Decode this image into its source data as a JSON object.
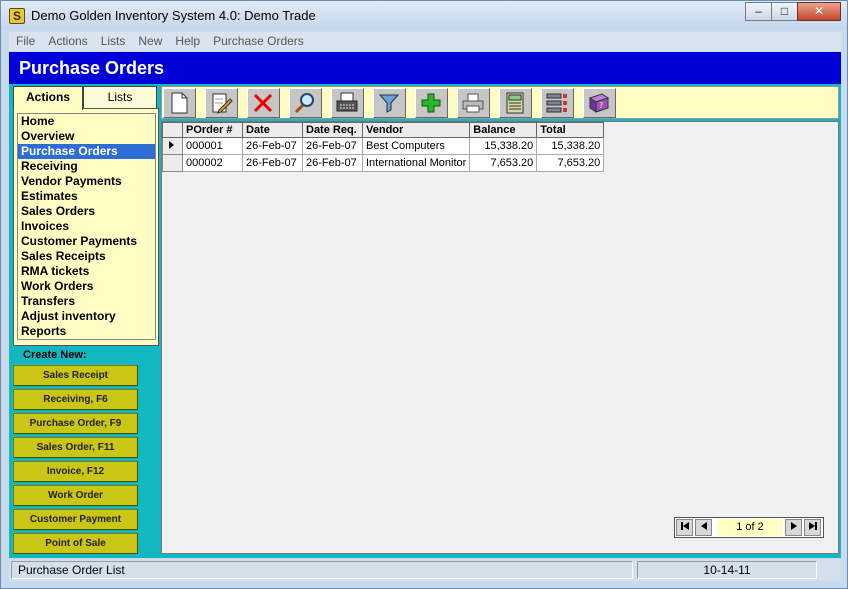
{
  "window": {
    "title": "Demo Golden Inventory System 4.0: Demo Trade",
    "app_icon_glyph": "S"
  },
  "menu": [
    "File",
    "Actions",
    "Lists",
    "New",
    "Help",
    "Purchase Orders"
  ],
  "header": {
    "title": "Purchase Orders",
    "bg_color": "#0000d6"
  },
  "tabs": {
    "actions": "Actions",
    "lists": "Lists"
  },
  "nav": {
    "selected": "Purchase Orders",
    "items": [
      "Home",
      "Overview",
      "Purchase Orders",
      "Receiving",
      "Vendor Payments",
      "Estimates",
      "Sales Orders",
      "Invoices",
      "Customer Payments",
      "Sales Receipts",
      "RMA tickets",
      "Work Orders",
      "Transfers",
      "Adjust inventory",
      "Reports"
    ]
  },
  "create_new": {
    "label": "Create New:",
    "buttons": [
      "Sales Receipt",
      "Receiving, F6",
      "Purchase Order, F9",
      "Sales Order, F11",
      "Invoice, F12",
      "Work Order",
      "Customer Payment",
      "Point of Sale"
    ]
  },
  "toolbar_icons": [
    "new-document-icon",
    "edit-icon",
    "delete-icon",
    "search-icon",
    "typewriter-icon",
    "funnel-icon",
    "add-icon",
    "print-icon",
    "calculator-icon",
    "list-view-icon",
    "help-book-icon"
  ],
  "grid": {
    "columns": [
      "POrder #",
      "Date",
      "Date Req.",
      "Vendor",
      "Balance",
      "Total"
    ],
    "rows": [
      [
        "000001",
        "26-Feb-07",
        "26-Feb-07",
        "Best Computers",
        "15,338.20",
        "15,338.20"
      ],
      [
        "000002",
        "26-Feb-07",
        "26-Feb-07",
        "International Monitor",
        "7,653.20",
        "7,653.20"
      ]
    ]
  },
  "pager": {
    "text": "1 of 2"
  },
  "status": {
    "left": "Purchase Order List",
    "right": "10-14-11"
  }
}
